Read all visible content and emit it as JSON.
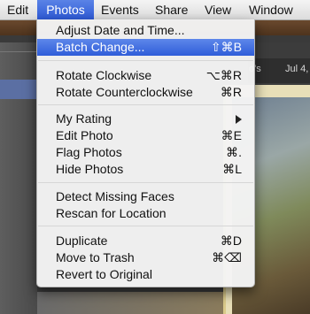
{
  "menubar": {
    "items": [
      "Edit",
      "Photos",
      "Events",
      "Share",
      "View",
      "Window"
    ]
  },
  "background": {
    "header_fragment": "o's",
    "date_fragment": "Jul 4, 1"
  },
  "menu": {
    "adjust": {
      "label": "Adjust Date and Time...",
      "shortcut": ""
    },
    "batch": {
      "label": "Batch Change...",
      "shortcut": "⇧⌘B"
    },
    "rotate_cw": {
      "label": "Rotate Clockwise",
      "shortcut": "⌥⌘R"
    },
    "rotate_ccw": {
      "label": "Rotate Counterclockwise",
      "shortcut": "⌘R"
    },
    "rating": {
      "label": "My Rating",
      "shortcut": ""
    },
    "edit_photo": {
      "label": "Edit Photo",
      "shortcut": "⌘E"
    },
    "flag": {
      "label": "Flag Photos",
      "shortcut": "⌘."
    },
    "hide": {
      "label": "Hide Photos",
      "shortcut": "⌘L"
    },
    "detect": {
      "label": "Detect Missing Faces",
      "shortcut": ""
    },
    "rescan": {
      "label": "Rescan for Location",
      "shortcut": ""
    },
    "duplicate": {
      "label": "Duplicate",
      "shortcut": "⌘D"
    },
    "trash": {
      "label": "Move to Trash",
      "shortcut": "⌘⌫"
    },
    "revert": {
      "label": "Revert to Original",
      "shortcut": ""
    }
  },
  "colors": {
    "highlight": "#3a66dd",
    "menu_bg": "#f4f4f4"
  }
}
